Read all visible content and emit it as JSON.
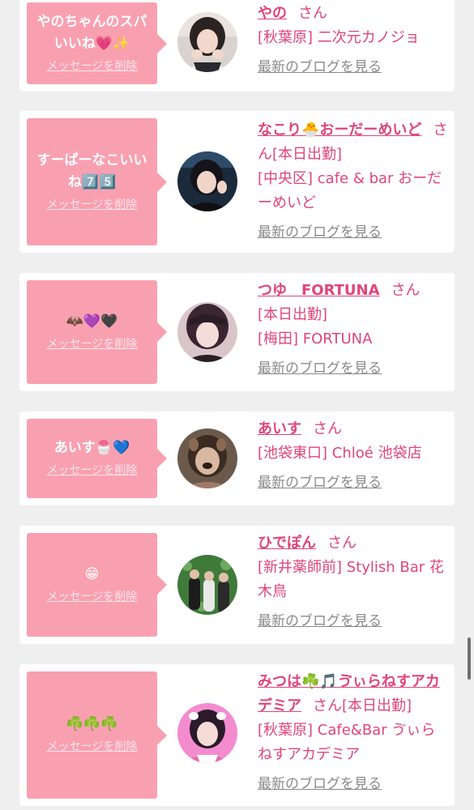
{
  "common": {
    "delete_label": "メッセージを削除",
    "honorific": "さん",
    "blog_label": "最新のブログを見る"
  },
  "entries": [
    {
      "message": "やのちゃんのスパいいね💗✨",
      "name": "やの",
      "status": "",
      "area": "[秋葉原]",
      "shop": "二次元カノジョ"
    },
    {
      "message": "すーぱーなこいいね7️⃣5️⃣",
      "name": "なこり🐣おーだーめいど",
      "status": "[本日出勤]",
      "area": "[中央区]",
      "shop": "cafe & bar おーだーめいど"
    },
    {
      "message": "🦇💜🖤",
      "name": "つゆ　FORTUNA",
      "status": "[本日出勤]",
      "area": "[梅田]",
      "shop": "FORTUNA"
    },
    {
      "message": "あいす🍧💙",
      "name": "あいす",
      "status": "",
      "area": "[池袋東口]",
      "shop": "Chloé 池袋店"
    },
    {
      "message": "😁",
      "name": "ひでぽん",
      "status": "",
      "area": "[新井薬師前]",
      "shop": "Stylish Bar 花木鳥"
    },
    {
      "message": "☘️☘️☘️",
      "name": "みつは☘️🎵ゔぃらねすアカデミア",
      "status": "[本日出勤]",
      "area": "[秋葉原]",
      "shop": "Cafe&Bar ゔぃらねすアカデミア"
    }
  ]
}
